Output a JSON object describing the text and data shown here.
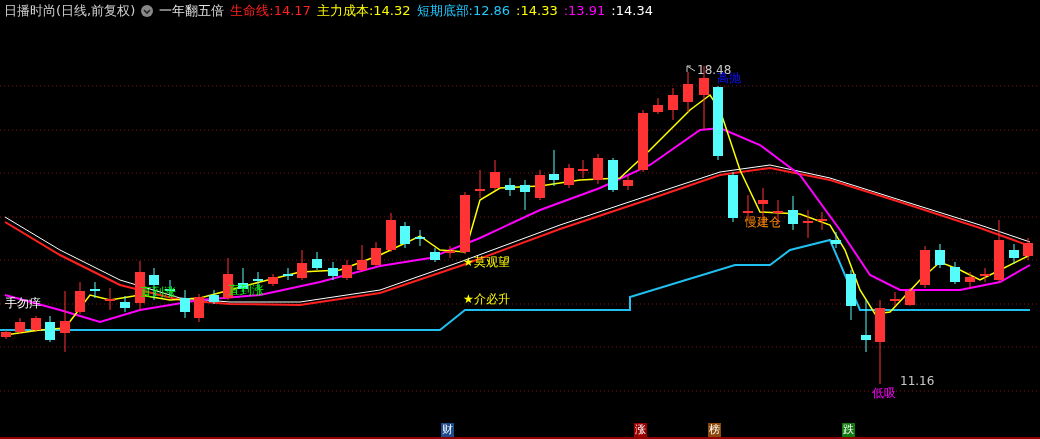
{
  "header": {
    "title": "日播时尚(日线,前复权)",
    "indicator": "一年翻五倍",
    "readings": [
      {
        "text": "生命线:14.17",
        "color": "#ff2020"
      },
      {
        "text": "主力成本:14.32",
        "color": "#ffff00"
      },
      {
        "text": "短期底部:12.86",
        "color": "#20c8ff"
      },
      {
        "text": ":14.33",
        "color": "#ffff00"
      },
      {
        "text": ":13.91",
        "color": "#ff00ff"
      },
      {
        "text": ":14.34",
        "color": "#ffffff"
      }
    ]
  },
  "chart": {
    "annotations": [
      {
        "text": "手勿痒"
      },
      {
        "text": "直到涨"
      },
      {
        "text": "直到涨"
      },
      {
        "text": "★莫观望"
      },
      {
        "text": "★介必升"
      },
      {
        "text": "高抛"
      },
      {
        "text": "慢建仓"
      },
      {
        "text": "低吸"
      }
    ],
    "price_labels": [
      {
        "text": "18.48"
      },
      {
        "text": "11.16"
      }
    ]
  },
  "markers": [
    {
      "text": "财",
      "color": "#1e4b8c"
    },
    {
      "text": "涨",
      "color": "#9b0000"
    },
    {
      "text": "榜",
      "color": "#8b4a0c"
    },
    {
      "text": "跌",
      "color": "#107a10"
    }
  ]
}
